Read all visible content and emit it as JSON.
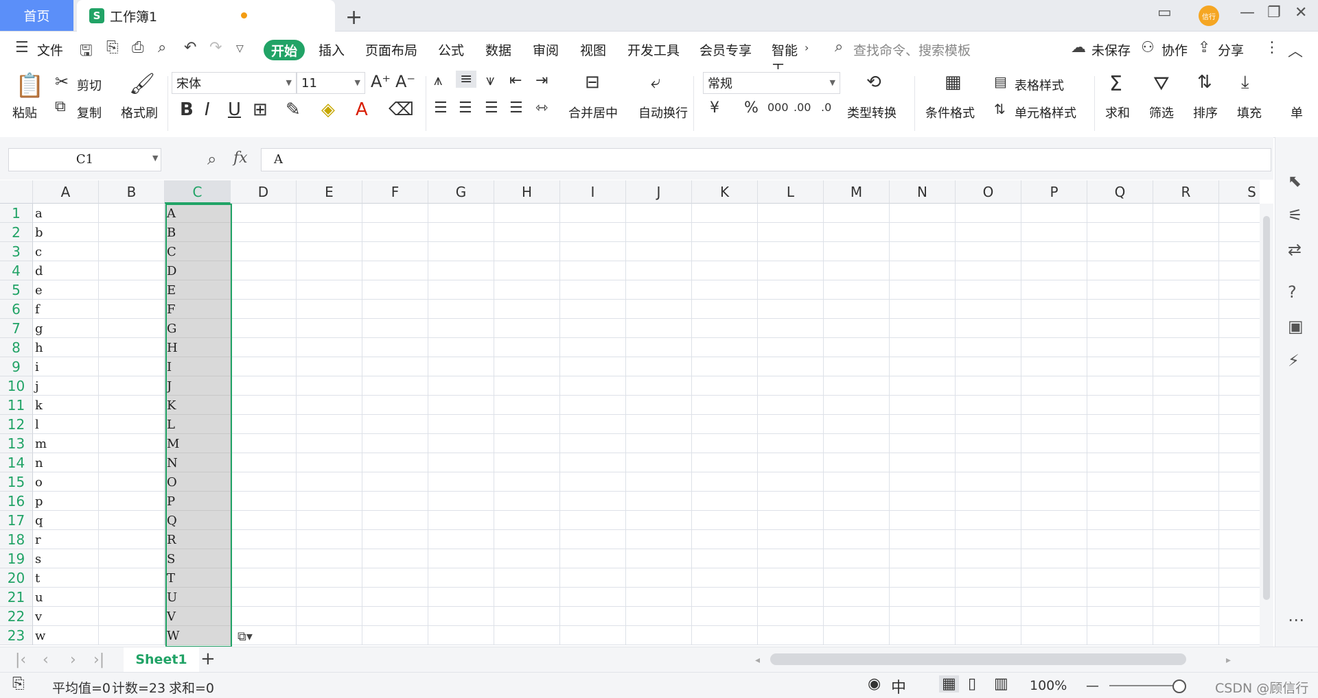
{
  "titlebar": {
    "home_tab": "首页",
    "doc_logo": "S",
    "doc_title": "工作簿1",
    "add_tab": "+",
    "avatar_text": "信行"
  },
  "menubar": {
    "file": "文件",
    "tabs": [
      "开始",
      "插入",
      "页面布局",
      "公式",
      "数据",
      "审阅",
      "视图",
      "开发工具",
      "会员专享",
      "智能工"
    ],
    "search_placeholder": "查找命令、搜索模板",
    "unsaved": "未保存",
    "collab": "协作",
    "share": "分享"
  },
  "ribbon": {
    "paste": "粘贴",
    "cut": "剪切",
    "copy": "复制",
    "format_painter": "格式刷",
    "font_name": "宋体",
    "font_size": "11",
    "merge_center": "合并居中",
    "wrap_text": "自动换行",
    "number_format": "常规",
    "type_convert": "类型转换",
    "conditional_format": "条件格式",
    "table_style": "表格样式",
    "cell_style": "单元格样式",
    "sum": "求和",
    "filter": "筛选",
    "sort": "排序",
    "fill": "填充",
    "single": "单"
  },
  "formulabar": {
    "name_box": "C1",
    "fx": "fx",
    "content": "A"
  },
  "grid": {
    "columns": [
      "A",
      "B",
      "C",
      "D",
      "E",
      "F",
      "G",
      "H",
      "I",
      "J",
      "K",
      "L",
      "M",
      "N",
      "O",
      "P",
      "Q",
      "R",
      "S"
    ],
    "selected_column": "C",
    "rows": [
      {
        "n": "1",
        "a": "a",
        "c": "A"
      },
      {
        "n": "2",
        "a": "b",
        "c": "B"
      },
      {
        "n": "3",
        "a": "c",
        "c": "C"
      },
      {
        "n": "4",
        "a": "d",
        "c": "D"
      },
      {
        "n": "5",
        "a": "e",
        "c": "E"
      },
      {
        "n": "6",
        "a": "f",
        "c": "F"
      },
      {
        "n": "7",
        "a": "g",
        "c": "G"
      },
      {
        "n": "8",
        "a": "h",
        "c": "H"
      },
      {
        "n": "9",
        "a": "i",
        "c": "I"
      },
      {
        "n": "10",
        "a": "j",
        "c": "J"
      },
      {
        "n": "11",
        "a": "k",
        "c": "K"
      },
      {
        "n": "12",
        "a": "l",
        "c": "L"
      },
      {
        "n": "13",
        "a": "m",
        "c": "M"
      },
      {
        "n": "14",
        "a": "n",
        "c": "N"
      },
      {
        "n": "15",
        "a": "o",
        "c": "O"
      },
      {
        "n": "16",
        "a": "p",
        "c": "P"
      },
      {
        "n": "17",
        "a": "q",
        "c": "Q"
      },
      {
        "n": "18",
        "a": "r",
        "c": "R"
      },
      {
        "n": "19",
        "a": "s",
        "c": "S"
      },
      {
        "n": "20",
        "a": "t",
        "c": "T"
      },
      {
        "n": "21",
        "a": "u",
        "c": "U"
      },
      {
        "n": "22",
        "a": "v",
        "c": "V"
      },
      {
        "n": "23",
        "a": "w",
        "c": "W"
      }
    ]
  },
  "sheetbar": {
    "sheet_name": "Sheet1",
    "add": "+"
  },
  "statusbar": {
    "average": "平均值=0",
    "count": "计数=23",
    "sum": "求和=0",
    "zoom": "100%",
    "watermark": "CSDN @顾信行"
  },
  "colors": {
    "accent": "#21a366",
    "home_tab": "#5b8ff9",
    "selection_fill": "#d9d9d9"
  }
}
